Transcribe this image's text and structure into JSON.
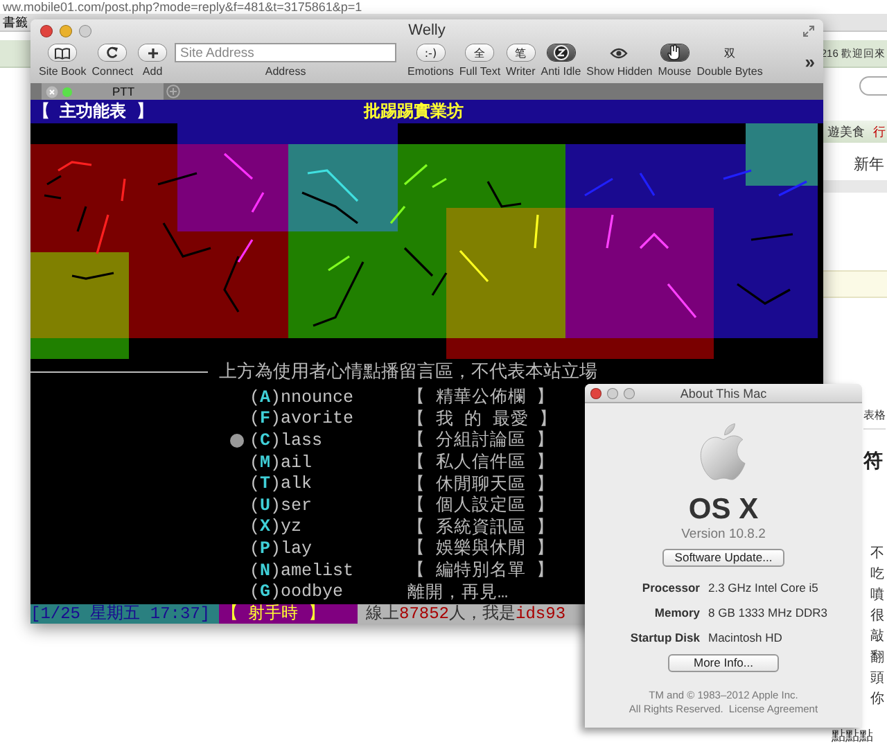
{
  "browser": {
    "url": "ww.mobile01.com/post.php?mode=reply&f=481&t=3175861&p=1",
    "bookmark": "書籤",
    "welcome": "216 歡迎回來",
    "nav": [
      {
        "text": "遊美食",
        "kind": "plain"
      },
      {
        "text": "行",
        "kind": "hot"
      }
    ],
    "heading": "新年",
    "table_link": "表格",
    "section": "符",
    "list": [
      "不",
      "吃",
      "噴",
      "很",
      "敲",
      "翻",
      "頭",
      "你",
      "點點點"
    ]
  },
  "welly": {
    "title": "Welly",
    "toolbar_left": [
      {
        "label": "Site Book"
      },
      {
        "label": "Connect"
      },
      {
        "label": "Add"
      }
    ],
    "address": {
      "placeholder": "Site Address",
      "label": "Address"
    },
    "toolbar_right": [
      {
        "label": "Emotions",
        "kind": "button",
        "glyph": ":-)",
        "on": false
      },
      {
        "label": "Full Text",
        "kind": "button",
        "glyph": "全",
        "on": false
      },
      {
        "label": "Writer",
        "kind": "button",
        "glyph": "笔",
        "on": false
      },
      {
        "label": "Anti Idle",
        "kind": "toggle",
        "on": true
      },
      {
        "label": "Show Hidden",
        "kind": "toggle",
        "on": false
      },
      {
        "label": "Mouse",
        "kind": "toggle",
        "on": true
      },
      {
        "label": "Double Bytes",
        "kind": "toggle",
        "glyph": "双",
        "on": false
      }
    ],
    "overflow": "»",
    "tabs": [
      {
        "label": "PTT",
        "selected": true
      }
    ],
    "terminal": {
      "title": "【 主功能表 】",
      "board": "批踢踢實業坊",
      "notice": "上方為使用者心情點播留言區，不代表本站立場",
      "menu": [
        {
          "label": "(**A**)nnounce",
          "desc": "【 精華公佈欄 】",
          "selected": false
        },
        {
          "label": "(**F**)avorite",
          "desc": "【 我 的 最愛 】",
          "selected": false
        },
        {
          "label": "(**C**)lass",
          "desc": "【 分組討論區 】",
          "selected": true
        },
        {
          "label": "(**M**)ail",
          "desc": "【 私人信件區 】",
          "selected": false
        },
        {
          "label": "(**T**)alk",
          "desc": "【 休閒聊天區 】",
          "selected": false
        },
        {
          "label": "(**U**)ser",
          "desc": "【 個人設定區 】",
          "selected": false
        },
        {
          "label": "(**X**)yz",
          "desc": "【 系統資訊區 】",
          "selected": false
        },
        {
          "label": "(**P**)lay",
          "desc": "【 娛樂與休閒 】",
          "selected": false
        },
        {
          "label": "(**N**)amelist",
          "desc": "【 編特別名單 】",
          "selected": false
        },
        {
          "label": "(**G**)oodbye",
          "desc": "離開，再見…",
          "selected": false
        }
      ],
      "status": [
        {
          "kind": "date",
          "text": "[1/25 星期五 17:37]"
        },
        {
          "kind": "sign",
          "text": "【 射手時 】"
        },
        {
          "kind": "online",
          "text": "線上**87852**人，我是**ids93**"
        }
      ]
    }
  },
  "about": {
    "title": "About This Mac",
    "os": "OS X",
    "version": "Version 10.8.2",
    "update_button": "Software Update...",
    "specs": [
      {
        "label": "Processor",
        "value": "2.3 GHz Intel Core i5"
      },
      {
        "label": "Memory",
        "value": "8 GB 1333 MHz DDR3"
      },
      {
        "label": "Startup Disk",
        "value": "Macintosh HD"
      }
    ],
    "more_button": "More Info...",
    "footer": [
      "TM and © 1983–2012 Apple Inc.",
      "All Rights Reserved."
    ],
    "license_link": "License Agreement"
  }
}
